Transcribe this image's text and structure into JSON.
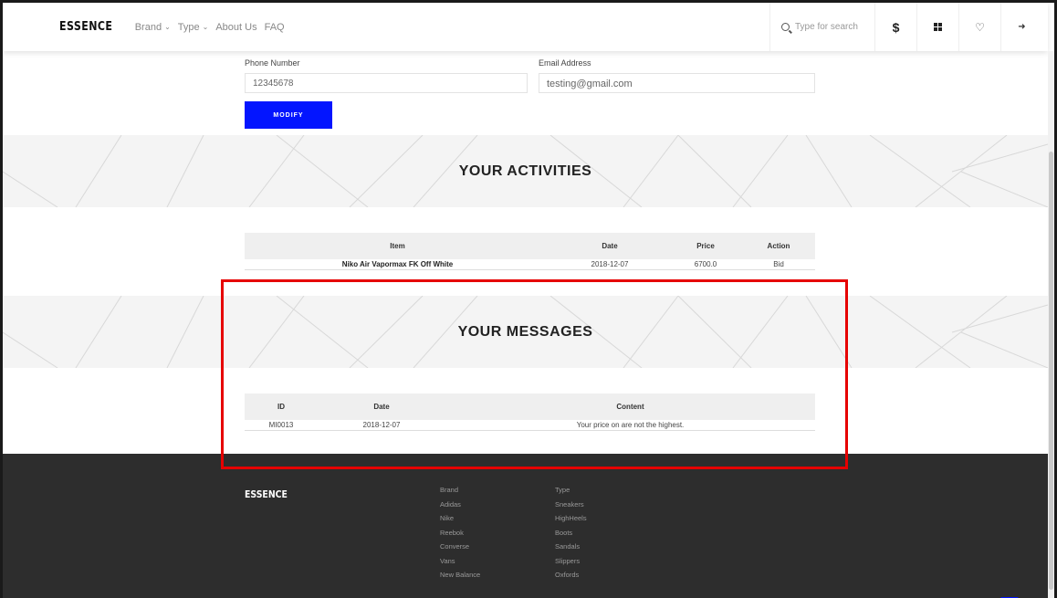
{
  "header": {
    "logo": "ESSENCE",
    "nav": [
      {
        "label": "Brand",
        "has_dropdown": true
      },
      {
        "label": "Type",
        "has_dropdown": true
      },
      {
        "label": "About Us",
        "has_dropdown": false
      },
      {
        "label": "FAQ",
        "has_dropdown": false
      }
    ],
    "search_placeholder": "Type for search",
    "icons": [
      "search-icon",
      "dollar-icon",
      "grid-icon",
      "heart-icon",
      "logout-icon"
    ],
    "dollar_label": "$"
  },
  "profile": {
    "phone_label": "Phone Number",
    "phone_value": "12345678",
    "email_label": "Email Address",
    "email_value": "testing@gmail.com",
    "modify_label": "MODIFY"
  },
  "activities": {
    "title": "YOUR ACTIVITIES",
    "columns": [
      "Item",
      "Date",
      "Price",
      "Action"
    ],
    "rows": [
      {
        "item": "Niko Air Vapormax FK Off White",
        "date": "2018-12-07",
        "price": "6700.0",
        "action": "Bid"
      }
    ]
  },
  "messages": {
    "title": "YOUR MESSAGES",
    "columns": [
      "ID",
      "Date",
      "Content"
    ],
    "rows": [
      {
        "id": "MI0013",
        "date": "2018-12-07",
        "content": "Your price on are not the highest."
      }
    ]
  },
  "footer": {
    "logo": "ESSENCE",
    "brand_col": [
      "Brand",
      "Adidas",
      "Nike",
      "Reebok",
      "Converse",
      "Vans",
      "New Balance"
    ],
    "type_col": [
      "Type",
      "Sneakers",
      "HighHeels",
      "Boots",
      "Sandals",
      "Slippers",
      "Oxfords"
    ],
    "to_top_icon": "chevron-up-icon"
  },
  "colors": {
    "accent": "#0315ff",
    "highlight_box": "#e60000",
    "footer_bg": "#2d2d2d"
  }
}
